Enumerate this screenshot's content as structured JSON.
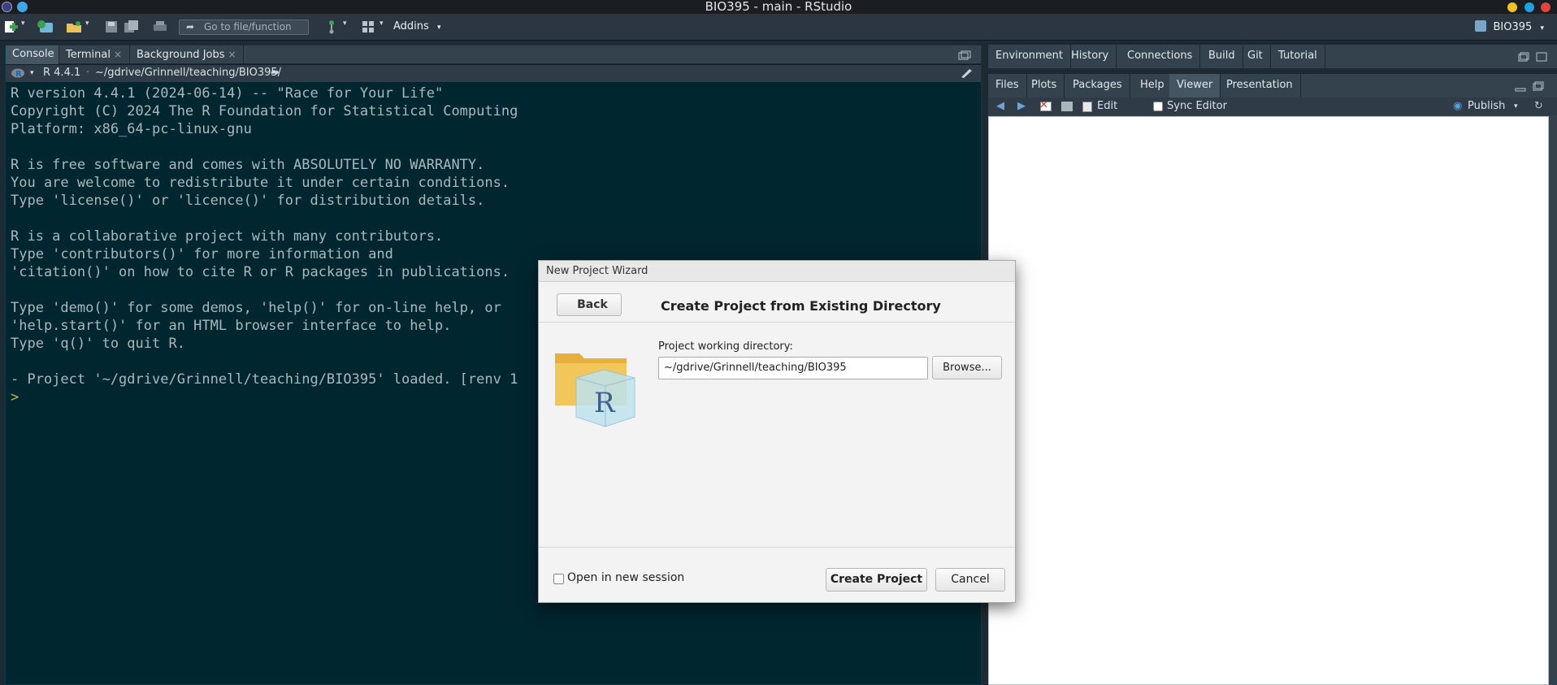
{
  "window": {
    "title": "BIO395 - main - RStudio",
    "colors": {
      "close": "#e0443e",
      "maximize": "#1fa0e0",
      "minimize": "#f2c11d"
    }
  },
  "toolbar": {
    "goto_placeholder": "Go to file/function",
    "addins_label": "Addins",
    "project_label": "BIO395"
  },
  "left_pane": {
    "tabs": [
      {
        "label": "Console",
        "active": true
      },
      {
        "label": "Terminal",
        "close": "×"
      },
      {
        "label": "Background Jobs",
        "close": "×"
      }
    ],
    "r_version": "R 4.4.1",
    "path": "~/gdrive/Grinnell/teaching/BIO395/",
    "console_lines": [
      "R version 4.4.1 (2024-06-14) -- \"Race for Your Life\"",
      "Copyright (C) 2024 The R Foundation for Statistical Computing",
      "Platform: x86_64-pc-linux-gnu",
      "",
      "R is free software and comes with ABSOLUTELY NO WARRANTY.",
      "You are welcome to redistribute it under certain conditions.",
      "Type 'license()' or 'licence()' for distribution details.",
      "",
      "R is a collaborative project with many contributors.",
      "Type 'contributors()' for more information and",
      "'citation()' on how to cite R or R packages in publications.",
      "",
      "Type 'demo()' for some demos, 'help()' for on-line help, or",
      "'help.start()' for an HTML browser interface to help.",
      "Type 'q()' to quit R.",
      "",
      "- Project '~/gdrive/Grinnell/teaching/BIO395' loaded. [renv 1"
    ],
    "prompt": ">"
  },
  "right_top": {
    "tabs": [
      "Environment",
      "History",
      "Connections",
      "Build",
      "Git",
      "Tutorial"
    ]
  },
  "right_bottom": {
    "tabs": [
      "Files",
      "Plots",
      "Packages",
      "Help",
      "Viewer",
      "Presentation"
    ],
    "active_tab": "Viewer",
    "edit_label": "Edit",
    "sync_label": "Sync Editor",
    "publish_label": "Publish"
  },
  "dialog": {
    "title": "New Project Wizard",
    "back_label": "Back",
    "heading": "Create Project from Existing Directory",
    "dir_label": "Project working directory:",
    "dir_value": "~/gdrive/Grinnell/teaching/BIO395",
    "browse_label": "Browse...",
    "new_session_label": "Open in new session",
    "create_label": "Create Project",
    "cancel_label": "Cancel",
    "folder_icon_letter": "R"
  }
}
